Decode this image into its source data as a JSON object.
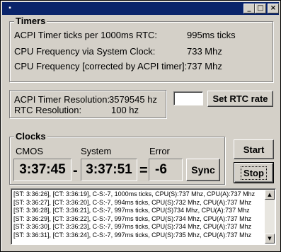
{
  "window": {
    "title": "",
    "icon": "app-icon",
    "controls": {
      "minimize": "_",
      "maximize": "□",
      "close": "×"
    }
  },
  "timers": {
    "title": "Timers",
    "acpi_ticks_label": "ACPI Timer ticks per 1000ms RTC:",
    "acpi_ticks_value": "995ms ticks",
    "cpu_freq_label": "CPU Frequency via System Clock:",
    "cpu_freq_value": "733 Mhz",
    "cpu_freq_corr_label": "CPU Frequency [corrected by ACPI timer]:",
    "cpu_freq_corr_value": "737 Mhz"
  },
  "resolution": {
    "acpi_label": "ACPI Timer Resolution:",
    "acpi_value": "3579545 hz",
    "rtc_label": "RTC Resolution:",
    "rtc_value": "100 hz"
  },
  "rtc_rate": {
    "input_value": "",
    "button_label": "Set RTC rate"
  },
  "clocks": {
    "title": "Clocks",
    "cmos_label": "CMOS",
    "system_label": "System",
    "error_label": "Error",
    "cmos_value": "3:37:45",
    "system_value": "3:37:51",
    "error_value": "-6",
    "minus_sign": "-",
    "equals_sign": "=",
    "sync_label": "Sync"
  },
  "controls": {
    "start_label": "Start",
    "stop_label": "Stop"
  },
  "log": {
    "lines": [
      "[ST: 3:36:26], [CT: 3:36:19], C-S:-7, 1000ms ticks, CPU(S):737 Mhz, CPU(A):737 Mhz",
      "[ST: 3:36:27], [CT: 3:36:20], C-S:-7, 994ms ticks, CPU(S):732 Mhz, CPU(A):737 Mhz",
      "[ST: 3:36:28], [CT: 3:36:21], C-S:-7, 997ms ticks, CPU(S)734 Mhz, CPU(A):737 Mhz",
      "[ST: 3:36:29], [CT: 3:36:22], C-S:-7, 997ms ticks, CPU(S):734 Mhz, CPU(A):737 Mhz",
      "[ST: 3:36:30], [CT: 3:36:23], C-S:-7, 997ms ticks, CPU(S):734 Mhz, CPU(A):737 Mhz",
      "[ST: 3:36:31], [CT: 3:36:24], C-S:-7, 997ms ticks, CPU(S):735 Mhz, CPU(A):737 Mhz"
    ]
  },
  "colors": {
    "titlebar": "#0a246a",
    "face": "#d4d0c8"
  }
}
